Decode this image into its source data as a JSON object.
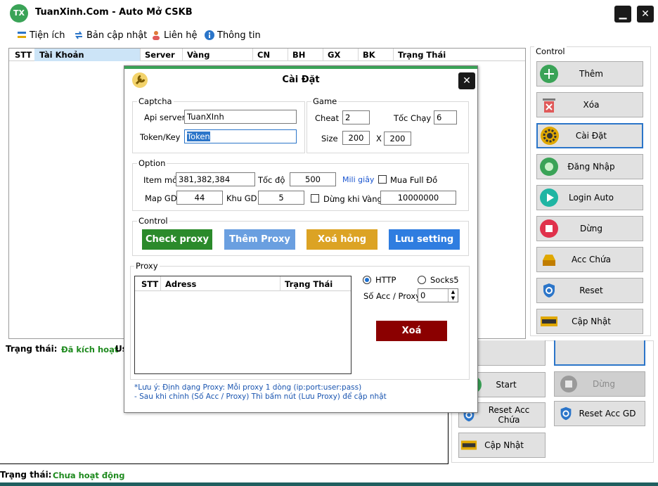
{
  "app": {
    "logo_text": "TX",
    "title": "TuanXinh.Com - Auto Mở CSKB",
    "minimize_label": "▁",
    "close_label": "✕"
  },
  "menu": [
    {
      "label": "Tiện ích",
      "icon": "tools-icon"
    },
    {
      "label": "Bản cập nhật",
      "icon": "sync-icon"
    },
    {
      "label": "Liên hệ",
      "icon": "person-icon"
    },
    {
      "label": "Thông tin",
      "icon": "info-icon"
    }
  ],
  "grid": {
    "columns": [
      "STT",
      "Tài Khoản",
      "Server",
      "Vàng",
      "CN",
      "BH",
      "GX",
      "BK",
      "Trạng Thái"
    ]
  },
  "control": {
    "label": "Control",
    "buttons": [
      {
        "label": "Thêm",
        "icon": "plus-icon",
        "color": "#3aa357"
      },
      {
        "label": "Xóa",
        "icon": "trash-icon",
        "color": "#d9534f"
      },
      {
        "label": "Cài Đặt",
        "icon": "gear-icon",
        "color": "#e0a800"
      },
      {
        "label": "Đăng Nhập",
        "icon": "record-icon",
        "color": "#3aa357"
      },
      {
        "label": "Login Auto",
        "icon": "play-icon",
        "color": "#1fb5a3"
      },
      {
        "label": "Dừng",
        "icon": "stop-icon",
        "color": "#e0314b"
      },
      {
        "label": "Acc Chứa",
        "icon": "inbox-icon",
        "color": "#e0a800"
      },
      {
        "label": "Reset",
        "icon": "shield-refresh-icon",
        "color": "#2b75c9"
      },
      {
        "label": "Cập Nhật",
        "icon": "update-icon",
        "color": "#e0a800"
      }
    ]
  },
  "status": {
    "label1": "Trạng thái:",
    "value1": "Đã kích hoạt",
    "extra1": "Us",
    "label2": "Trạng thái:",
    "value2": "Chưa hoạt động"
  },
  "bottom_panel": {
    "buttons": [
      {
        "label": "Start",
        "icon": "record-icon"
      },
      {
        "label": "Dừng",
        "icon": "stop-icon"
      },
      {
        "label": "Reset Acc Chứa",
        "icon": "shield-refresh-icon"
      },
      {
        "label": "Reset Acc GD",
        "icon": "shield-refresh-icon"
      },
      {
        "label": "Cập Nhật",
        "icon": "update-icon"
      }
    ]
  },
  "dialog": {
    "title": "Cài Đặt",
    "close_label": "✕",
    "captcha": {
      "label": "Captcha",
      "api_server_label": "Api server",
      "api_server_value": "TuanXInh",
      "token_label": "Token/Key",
      "token_value": "Token"
    },
    "game": {
      "label": "Game",
      "cheat_label": "Cheat",
      "cheat_value": "2",
      "speed_label": "Tốc Chạy",
      "speed_value": "6",
      "size_label": "Size",
      "size_w": "200",
      "size_x": "X",
      "size_h": "200"
    },
    "option": {
      "label": "Option",
      "item_label": "Item mở",
      "item_value": "381,382,384",
      "tocdo_label": "Tốc độ",
      "tocdo_value": "500",
      "mili_label": "Mili giây",
      "buy_full_label": "Mua Full Đồ",
      "buy_full_checked": false,
      "mapgd_label": "Map GD",
      "mapgd_value": "44",
      "khugd_label": "Khu GD",
      "khugd_value": "5",
      "stop_gold_label": "Dừng khi Vàng",
      "stop_gold_checked": false,
      "stop_gold_value": "10000000"
    },
    "control": {
      "label": "Control",
      "check_proxy": "Check proxy",
      "add_proxy": "Thêm Proxy",
      "remove_bad": "Xoá hỏng",
      "save_setting": "Lưu setting",
      "colors": {
        "check": "#2b8a2b",
        "add": "#6a9fe0",
        "remove": "#dca324",
        "save": "#2f7de0"
      }
    },
    "proxy": {
      "label": "Proxy",
      "columns": [
        "STT",
        "Adress",
        "Trạng Thái"
      ],
      "http_label": "HTTP",
      "http_selected": true,
      "socks_label": "Socks5",
      "acc_per_proxy_label": "Số Acc / Proxy",
      "acc_per_proxy_value": "0",
      "delete_label": "Xoá",
      "delete_color": "#8b0000"
    },
    "notes": [
      "*Lưu ý:  Định dạng Proxy: Mỗi proxy 1 dòng (ip:port:user:pass)",
      "- Sau khi chỉnh (Số Acc / Proxy) Thì bấm nút (Lưu Proxy) để cập nhật"
    ]
  }
}
